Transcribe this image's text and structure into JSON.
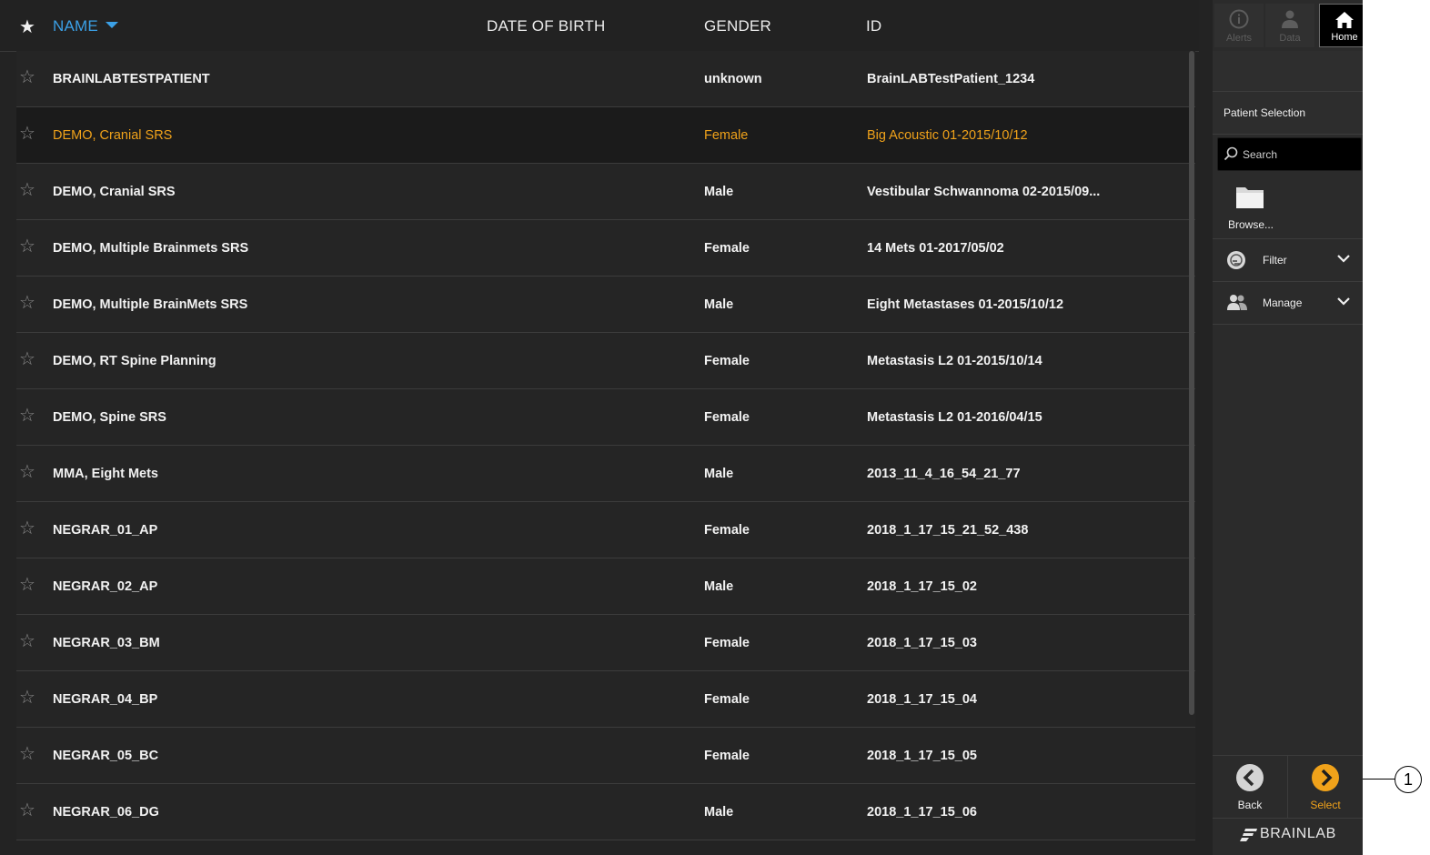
{
  "colors": {
    "accent_blue": "#3ba0e6",
    "accent_orange": "#f0a21a"
  },
  "table": {
    "headers": {
      "name": "NAME",
      "date_of_birth": "DATE OF BIRTH",
      "gender": "GENDER",
      "id": "ID"
    },
    "rows": [
      {
        "name": "BRAINLABTESTPATIENT",
        "gender": "unknown",
        "id": "BrainLABTestPatient_1234"
      },
      {
        "name": "DEMO, Cranial SRS",
        "gender": "Female",
        "id": "Big Acoustic 01-2015/10/12",
        "selected": true
      },
      {
        "name": "DEMO, Cranial SRS",
        "gender": "Male",
        "id": "Vestibular Schwannoma 02-2015/09..."
      },
      {
        "name": "DEMO, Multiple Brainmets SRS",
        "gender": "Female",
        "id": "14 Mets 01-2017/05/02"
      },
      {
        "name": "DEMO, Multiple BrainMets SRS",
        "gender": "Male",
        "id": "Eight Metastases 01-2015/10/12"
      },
      {
        "name": "DEMO, RT Spine Planning",
        "gender": "Female",
        "id": "Metastasis L2 01-2015/10/14"
      },
      {
        "name": "DEMO, Spine SRS",
        "gender": "Female",
        "id": "Metastasis L2 01-2016/04/15"
      },
      {
        "name": "MMA, Eight Mets",
        "gender": "Male",
        "id": "2013_11_4_16_54_21_77"
      },
      {
        "name": "NEGRAR_01_AP",
        "gender": "Female",
        "id": "2018_1_17_15_21_52_438"
      },
      {
        "name": "NEGRAR_02_AP",
        "gender": "Male",
        "id": "2018_1_17_15_02"
      },
      {
        "name": "NEGRAR_03_BM",
        "gender": "Female",
        "id": "2018_1_17_15_03"
      },
      {
        "name": "NEGRAR_04_BP",
        "gender": "Female",
        "id": "2018_1_17_15_04"
      },
      {
        "name": "NEGRAR_05_BC",
        "gender": "Female",
        "id": "2018_1_17_15_05"
      },
      {
        "name": "NEGRAR_06_DG",
        "gender": "Male",
        "id": "2018_1_17_15_06"
      }
    ]
  },
  "sidebar": {
    "nav": {
      "alerts": "Alerts",
      "data": "Data",
      "home": "Home"
    },
    "title": "Patient Selection",
    "search_placeholder": "Search",
    "browse": "Browse...",
    "filter": "Filter",
    "manage": "Manage",
    "back": "Back",
    "select": "Select",
    "brand": "BRAINLAB"
  },
  "callout": "1"
}
